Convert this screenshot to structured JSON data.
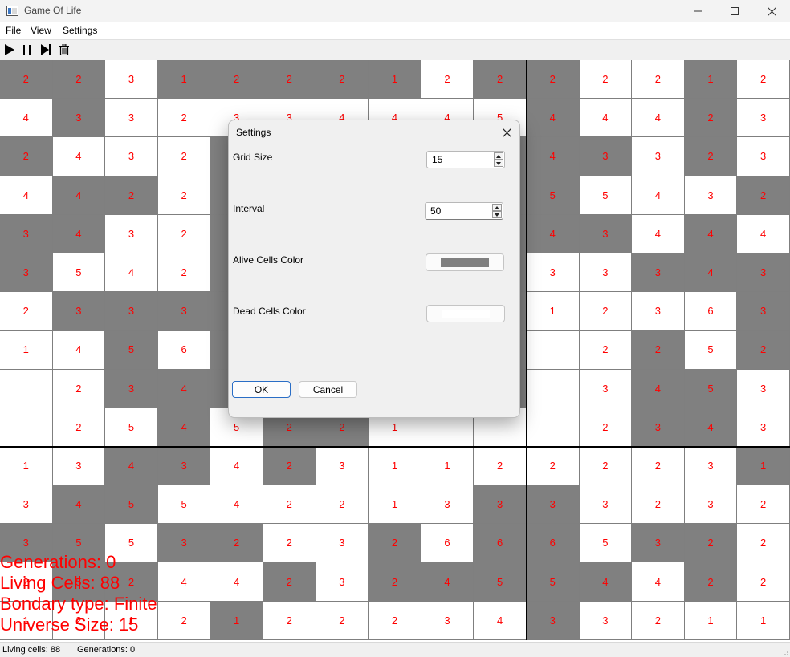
{
  "window": {
    "title": "Game Of Life"
  },
  "menu": {
    "file": "File",
    "view": "View",
    "settings": "Settings"
  },
  "toolbar": {
    "icons": [
      "play-icon",
      "pause-icon",
      "step-icon",
      "trash-icon"
    ]
  },
  "colors": {
    "alive": "#808080",
    "dead": "#ffffff",
    "count": "#ff0000"
  },
  "grid": {
    "size": 15,
    "rows": [
      {
        "alive": [
          1,
          1,
          0,
          1,
          1,
          1,
          1,
          1,
          0,
          1,
          1,
          0,
          0,
          1,
          0
        ],
        "counts": [
          "2",
          "2",
          "3",
          "1",
          "2",
          "2",
          "2",
          "1",
          "2",
          "2",
          "2",
          "2",
          "2",
          "1",
          "2"
        ]
      },
      {
        "alive": [
          0,
          1,
          0,
          0,
          0,
          0,
          0,
          0,
          0,
          0,
          1,
          0,
          0,
          1,
          0
        ],
        "counts": [
          "4",
          "3",
          "3",
          "2",
          "3",
          "3",
          "4",
          "4",
          "4",
          "5",
          "4",
          "4",
          "4",
          "2",
          "3"
        ]
      },
      {
        "alive": [
          1,
          0,
          0,
          0,
          1,
          1,
          1,
          1,
          1,
          1,
          1,
          1,
          0,
          1,
          0
        ],
        "counts": [
          "2",
          "4",
          "3",
          "2",
          "",
          "",
          "",
          "",
          "",
          "",
          "4",
          "3",
          "3",
          "2",
          "3"
        ]
      },
      {
        "alive": [
          0,
          1,
          1,
          0,
          1,
          1,
          1,
          1,
          1,
          1,
          1,
          0,
          0,
          0,
          1
        ],
        "counts": [
          "4",
          "4",
          "2",
          "2",
          "",
          "",
          "",
          "",
          "",
          "",
          "5",
          "5",
          "4",
          "3",
          "2"
        ]
      },
      {
        "alive": [
          1,
          1,
          0,
          0,
          1,
          1,
          1,
          1,
          1,
          1,
          1,
          1,
          0,
          1,
          0
        ],
        "counts": [
          "3",
          "4",
          "3",
          "2",
          "",
          "",
          "",
          "",
          "",
          "",
          "4",
          "3",
          "4",
          "4",
          "4"
        ]
      },
      {
        "alive": [
          1,
          0,
          0,
          0,
          1,
          1,
          1,
          1,
          1,
          1,
          0,
          0,
          1,
          1,
          1
        ],
        "counts": [
          "3",
          "5",
          "4",
          "2",
          "",
          "",
          "",
          "",
          "",
          "",
          "3",
          "3",
          "3",
          "4",
          "3"
        ]
      },
      {
        "alive": [
          0,
          1,
          1,
          1,
          1,
          1,
          1,
          1,
          1,
          1,
          0,
          0,
          0,
          0,
          1
        ],
        "counts": [
          "2",
          "3",
          "3",
          "3",
          "",
          "",
          "",
          "",
          "",
          "",
          "1",
          "2",
          "3",
          "6",
          "3"
        ]
      },
      {
        "alive": [
          0,
          0,
          1,
          0,
          1,
          1,
          1,
          1,
          1,
          1,
          0,
          0,
          1,
          0,
          1
        ],
        "counts": [
          "1",
          "4",
          "5",
          "6",
          "",
          "",
          "",
          "",
          "",
          "",
          "",
          "2",
          "2",
          "5",
          "2"
        ]
      },
      {
        "alive": [
          0,
          0,
          1,
          1,
          1,
          1,
          1,
          1,
          1,
          1,
          0,
          0,
          1,
          1,
          0
        ],
        "counts": [
          "",
          "2",
          "3",
          "4",
          "",
          "",
          "",
          "",
          "",
          "",
          "",
          "3",
          "4",
          "5",
          "3"
        ]
      },
      {
        "alive": [
          0,
          0,
          0,
          1,
          0,
          1,
          1,
          0,
          0,
          0,
          0,
          0,
          1,
          1,
          0
        ],
        "counts": [
          "",
          "2",
          "5",
          "4",
          "5",
          "2",
          "2",
          "1",
          "",
          "",
          "",
          "2",
          "3",
          "4",
          "3"
        ]
      },
      {
        "alive": [
          0,
          0,
          1,
          1,
          0,
          1,
          0,
          0,
          0,
          0,
          0,
          0,
          0,
          0,
          1
        ],
        "counts": [
          "1",
          "3",
          "4",
          "3",
          "4",
          "2",
          "3",
          "1",
          "1",
          "2",
          "2",
          "2",
          "2",
          "3",
          "1"
        ]
      },
      {
        "alive": [
          0,
          1,
          1,
          0,
          0,
          0,
          0,
          0,
          0,
          1,
          1,
          0,
          0,
          0,
          0
        ],
        "counts": [
          "3",
          "4",
          "5",
          "5",
          "4",
          "2",
          "2",
          "1",
          "3",
          "3",
          "3",
          "3",
          "2",
          "3",
          "2"
        ]
      },
      {
        "alive": [
          1,
          1,
          0,
          1,
          1,
          0,
          0,
          1,
          0,
          1,
          1,
          0,
          1,
          1,
          0
        ],
        "counts": [
          "3",
          "5",
          "5",
          "3",
          "2",
          "2",
          "3",
          "2",
          "6",
          "6",
          "6",
          "5",
          "3",
          "2",
          "2"
        ]
      },
      {
        "alive": [
          0,
          1,
          1,
          0,
          0,
          1,
          0,
          1,
          1,
          1,
          1,
          1,
          0,
          1,
          0
        ],
        "counts": [
          "2",
          "5",
          "2",
          "4",
          "4",
          "2",
          "3",
          "2",
          "4",
          "5",
          "5",
          "4",
          "4",
          "2",
          "2"
        ]
      },
      {
        "alive": [
          0,
          0,
          0,
          0,
          1,
          0,
          0,
          0,
          0,
          0,
          1,
          0,
          0,
          0,
          0
        ],
        "counts": [
          "1",
          "2",
          "1",
          "2",
          "1",
          "2",
          "2",
          "2",
          "3",
          "4",
          "3",
          "3",
          "2",
          "1",
          "1"
        ]
      }
    ]
  },
  "overlay": {
    "generations": "Generations: 0",
    "living": "Living Cells: 88",
    "boundary": "Bondary type: Finite",
    "universe": "Universe Size: 15"
  },
  "status": {
    "living": "Living cells: 88",
    "generations": "Generations: 0"
  },
  "dialog": {
    "title": "Settings",
    "grid_size_label": "Grid Size",
    "grid_size_value": "15",
    "interval_label": "Interval",
    "interval_value": "50",
    "alive_color_label": "Alive Cells Color",
    "dead_color_label": "Dead Cells Color",
    "ok": "OK",
    "cancel": "Cancel"
  }
}
